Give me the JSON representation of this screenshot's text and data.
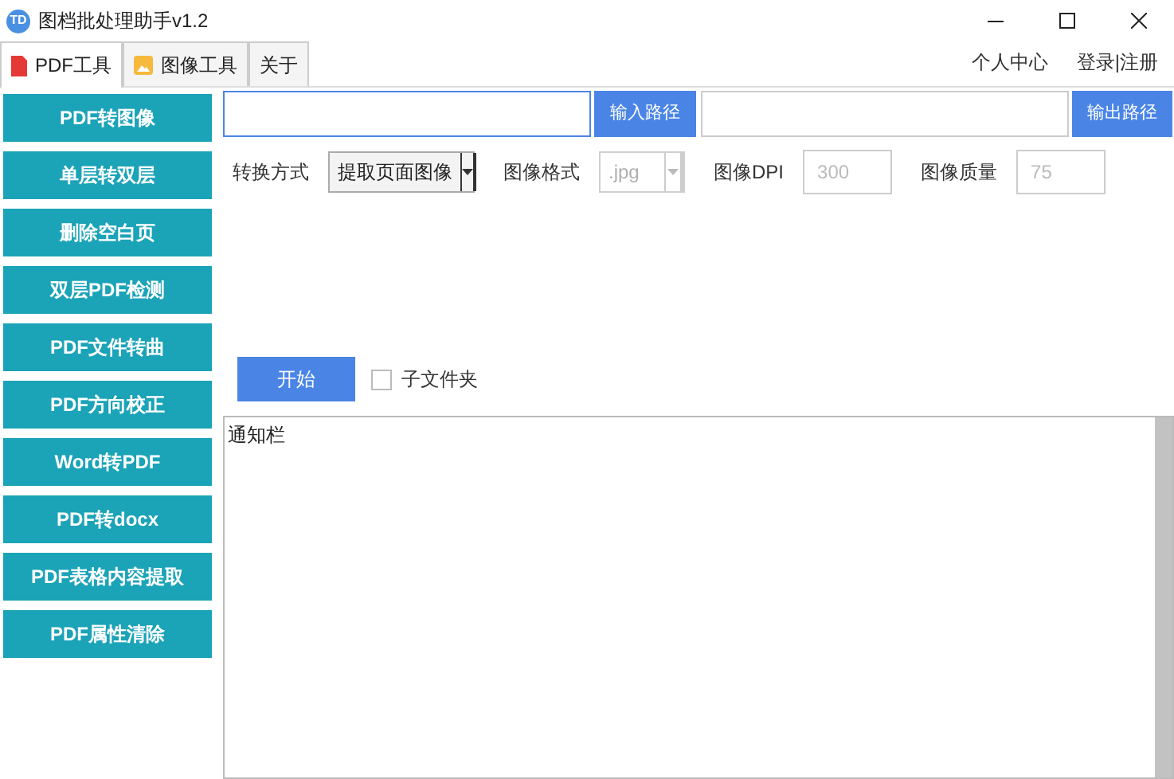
{
  "window": {
    "logo": "TD",
    "title": "图档批处理助手v1.2"
  },
  "tabs": [
    {
      "label": "PDF工具",
      "kind": "pdf",
      "selected": true
    },
    {
      "label": "图像工具",
      "kind": "image",
      "selected": false
    },
    {
      "label": "关于",
      "kind": "plain",
      "selected": false
    }
  ],
  "header_links": [
    "个人中心",
    "登录|注册"
  ],
  "sidebar": {
    "items": [
      "PDF转图像",
      "单层转双层",
      "删除空白页",
      "双层PDF检测",
      "PDF文件转曲",
      "PDF方向校正",
      "Word转PDF",
      "PDF转docx",
      "PDF表格内容提取",
      "PDF属性清除"
    ]
  },
  "paths": {
    "input_button": "输入路径",
    "output_button": "输出路径"
  },
  "options": [
    {
      "label": "转换方式",
      "kind": "select",
      "value": "提取页面图像",
      "disabled": false
    },
    {
      "label": "图像格式",
      "kind": "select",
      "value": ".jpg",
      "disabled": true
    },
    {
      "label": "图像DPI",
      "kind": "input",
      "placeholder": "300"
    },
    {
      "label": "图像质量",
      "kind": "input",
      "placeholder": "75"
    }
  ],
  "start_button": "开始",
  "subfolder": {
    "label": "子文件夹",
    "checked": false
  },
  "log": {
    "text": "通知栏"
  }
}
